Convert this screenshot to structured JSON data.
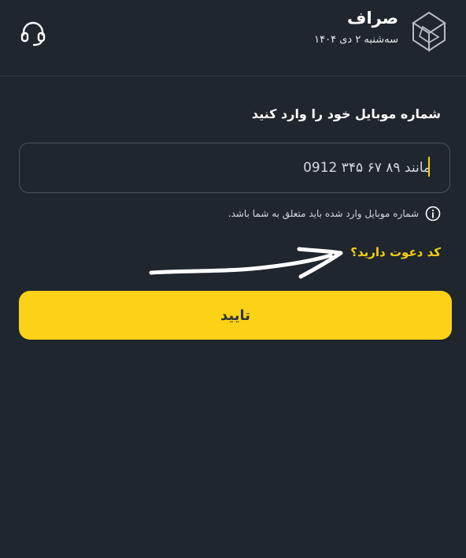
{
  "header": {
    "title": "صراف",
    "date": "سه‌شنبه ۲ دی ۱۴۰۴",
    "support_icon": "headset-icon",
    "logo_icon": "isometric-cube-icon"
  },
  "form": {
    "label": "شماره موبایل خود را وارد کنید",
    "phone_value": "",
    "phone_placeholder": "مانند ۸۹ ۶۷ ۳۴۵ 0912",
    "hint_icon": "info-icon",
    "hint": "شماره موبایل وارد شده باید متعلق به شما باشد.",
    "invite_link": "کد دعوت دارید؟",
    "submit": "تایید"
  },
  "colors": {
    "background": "#1f262d",
    "accent_yellow": "#fcd116",
    "link_yellow": "#f5cf16"
  }
}
